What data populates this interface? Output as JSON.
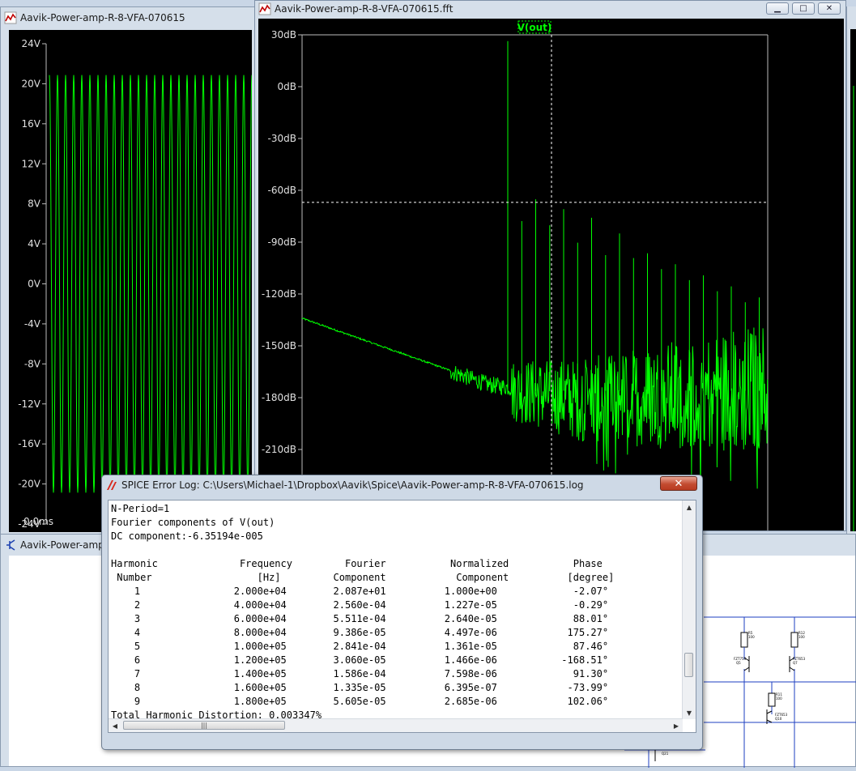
{
  "time_window": {
    "title": "Aavik-Power-amp-R-8-VFA-070615",
    "y_ticks": [
      "24V",
      "20V",
      "16V",
      "12V",
      "8V",
      "4V",
      "0V",
      "-4V",
      "-8V",
      "-12V",
      "-16V",
      "-20V",
      "-24V"
    ],
    "x_tick": "0.0ms",
    "trace_color": "#00ff00",
    "amplitude_v": 20.87,
    "cycles_visible": 25
  },
  "fft_window": {
    "title": "Aavik-Power-amp-R-8-VFA-070615.fft",
    "trace_label": "V(out)",
    "y_ticks": [
      "30dB",
      "0dB",
      "-30dB",
      "-60dB",
      "-90dB",
      "-120dB",
      "-150dB",
      "-180dB",
      "-210dB"
    ],
    "minimize_icon": "minimize-icon",
    "maximize_icon": "maximize-icon",
    "close_icon": "close-icon"
  },
  "schematic_window": {
    "title": "Aavik-Power-amp-R-8-VFA-070615"
  },
  "chart_data": {
    "type": "line",
    "ylabel": "",
    "ylim": [
      -240,
      30
    ],
    "harmonic_peaks_db": [
      26.4,
      -77.8,
      -65.2,
      -80.2,
      -70.9,
      -90.3,
      -75.9,
      -97.5,
      -85.0
    ],
    "grid": false
  },
  "log_window": {
    "title": "SPICE Error Log: C:\\Users\\Michael-1\\Dropbox\\Aavik\\Spice\\Aavik-Power-amp-R-8-VFA-070615.log",
    "close_label": "✕",
    "header_lines": [
      "N-Period=1",
      "Fourier components of V(out)",
      "DC component:-6.35194e-005"
    ],
    "columns": [
      [
        "Harmonic",
        " Number"
      ],
      [
        "Frequency",
        "   [Hz]"
      ],
      [
        " Fourier",
        "Component"
      ],
      [
        "Normalized",
        " Component"
      ],
      [
        " Phase",
        "[degree]"
      ]
    ],
    "rows": [
      [
        "1",
        "2.000e+04",
        "2.087e+01",
        "1.000e+00",
        "-2.07°"
      ],
      [
        "2",
        "4.000e+04",
        "2.560e-04",
        "1.227e-05",
        "-0.29°"
      ],
      [
        "3",
        "6.000e+04",
        "5.511e-04",
        "2.640e-05",
        "88.01°"
      ],
      [
        "4",
        "8.000e+04",
        "9.386e-05",
        "4.497e-06",
        "175.27°"
      ],
      [
        "5",
        "1.000e+05",
        "2.841e-04",
        "1.361e-05",
        "87.46°"
      ],
      [
        "6",
        "1.200e+05",
        "3.060e-05",
        "1.466e-06",
        "-168.51°"
      ],
      [
        "7",
        "1.400e+05",
        "1.586e-04",
        "7.598e-06",
        "91.30°"
      ],
      [
        "8",
        "1.600e+05",
        "1.335e-05",
        "6.395e-07",
        "-73.99°"
      ],
      [
        "9",
        "1.800e+05",
        "5.605e-05",
        "2.685e-06",
        "102.06°"
      ]
    ],
    "footer": "Total Harmonic Distortion: 0.003347%"
  }
}
